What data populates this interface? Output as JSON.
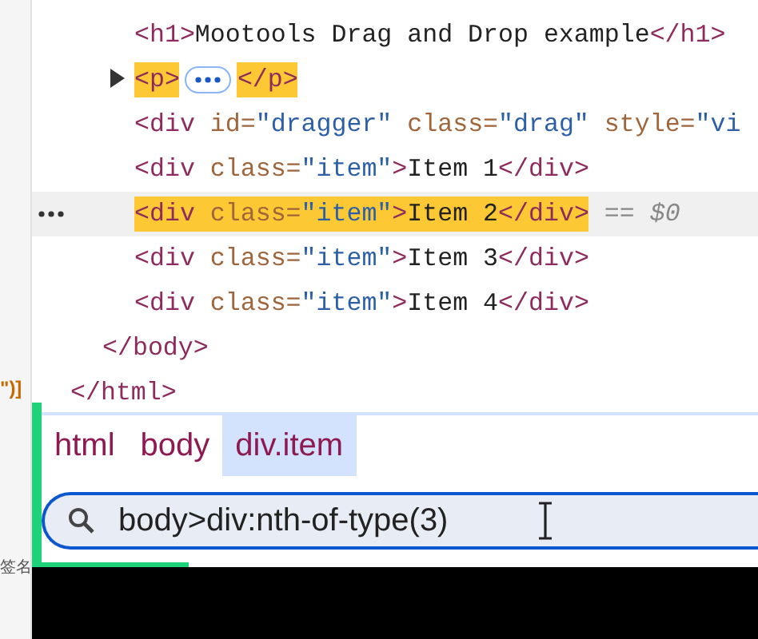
{
  "left_margin": [
    {
      "text": "\")]",
      "kind": "code"
    },
    {
      "text": "签名",
      "kind": "label"
    }
  ],
  "dom": {
    "close": [
      {
        "kind": "tag",
        "text": "</html>",
        "hl": false
      }
    ],
    "children": [
      {
        "close": [
          {
            "kind": "tag",
            "text": "</body>",
            "hl": false
          }
        ],
        "children": [
          {
            "selected": false,
            "expandable": false,
            "tokens": [
              {
                "kind": "tag",
                "text": "<h1>",
                "hl": false
              },
              {
                "kind": "text",
                "text": "Mootools Drag and Drop example",
                "hl": false
              },
              {
                "kind": "tag",
                "text": "</h1>",
                "hl": false
              }
            ]
          },
          {
            "selected": false,
            "expandable": true,
            "expanded": false,
            "tokens": [
              {
                "kind": "tag",
                "text": "<p>",
                "hl": true
              },
              {
                "kind": "ellipsis",
                "hl": false
              },
              {
                "kind": "tag",
                "text": "</p>",
                "hl": true
              }
            ]
          },
          {
            "selected": false,
            "expandable": false,
            "tokens": [
              {
                "kind": "tag",
                "text": "<div",
                "hl": false
              },
              {
                "kind": "attr",
                "text": " id=",
                "hl": false
              },
              {
                "kind": "value",
                "text": "\"dragger\"",
                "hl": false
              },
              {
                "kind": "attr",
                "text": " class=",
                "hl": false
              },
              {
                "kind": "value",
                "text": "\"drag\"",
                "hl": false
              },
              {
                "kind": "attr",
                "text": " style=",
                "hl": false
              },
              {
                "kind": "value",
                "text": "\"vi",
                "hl": false
              }
            ]
          },
          {
            "selected": false,
            "expandable": false,
            "tokens": [
              {
                "kind": "tag",
                "text": "<div",
                "hl": false
              },
              {
                "kind": "attr",
                "text": " class=",
                "hl": false
              },
              {
                "kind": "value",
                "text": "\"item\"",
                "hl": false
              },
              {
                "kind": "tag",
                "text": ">",
                "hl": false
              },
              {
                "kind": "text",
                "text": "Item 1",
                "hl": false
              },
              {
                "kind": "tag",
                "text": "</div>",
                "hl": false
              }
            ]
          },
          {
            "selected": true,
            "expandable": false,
            "tokens": [
              {
                "kind": "tag",
                "text": "<div",
                "hl": true
              },
              {
                "kind": "attr",
                "text": " class=",
                "hl": true
              },
              {
                "kind": "value",
                "text": "\"item\"",
                "hl": true
              },
              {
                "kind": "tag",
                "text": ">",
                "hl": true
              },
              {
                "kind": "text",
                "text": "Item 2",
                "hl": true
              },
              {
                "kind": "tag",
                "text": "</div>",
                "hl": true
              },
              {
                "kind": "hint",
                "text": " == $0",
                "hl": false
              }
            ]
          },
          {
            "selected": false,
            "expandable": false,
            "tokens": [
              {
                "kind": "tag",
                "text": "<div",
                "hl": false
              },
              {
                "kind": "attr",
                "text": " class=",
                "hl": false
              },
              {
                "kind": "value",
                "text": "\"item\"",
                "hl": false
              },
              {
                "kind": "tag",
                "text": ">",
                "hl": false
              },
              {
                "kind": "text",
                "text": "Item 3",
                "hl": false
              },
              {
                "kind": "tag",
                "text": "</div>",
                "hl": false
              }
            ]
          },
          {
            "selected": false,
            "expandable": false,
            "tokens": [
              {
                "kind": "tag",
                "text": "<div",
                "hl": false
              },
              {
                "kind": "attr",
                "text": " class=",
                "hl": false
              },
              {
                "kind": "value",
                "text": "\"item\"",
                "hl": false
              },
              {
                "kind": "tag",
                "text": ">",
                "hl": false
              },
              {
                "kind": "text",
                "text": "Item 4",
                "hl": false
              },
              {
                "kind": "tag",
                "text": "</div>",
                "hl": false
              }
            ]
          }
        ]
      }
    ]
  },
  "breadcrumbs": [
    {
      "label": "html",
      "selected": false
    },
    {
      "label": "body",
      "selected": false
    },
    {
      "label": "div.item",
      "selected": true
    }
  ],
  "search": {
    "value": "body>div:nth-of-type(3)"
  }
}
